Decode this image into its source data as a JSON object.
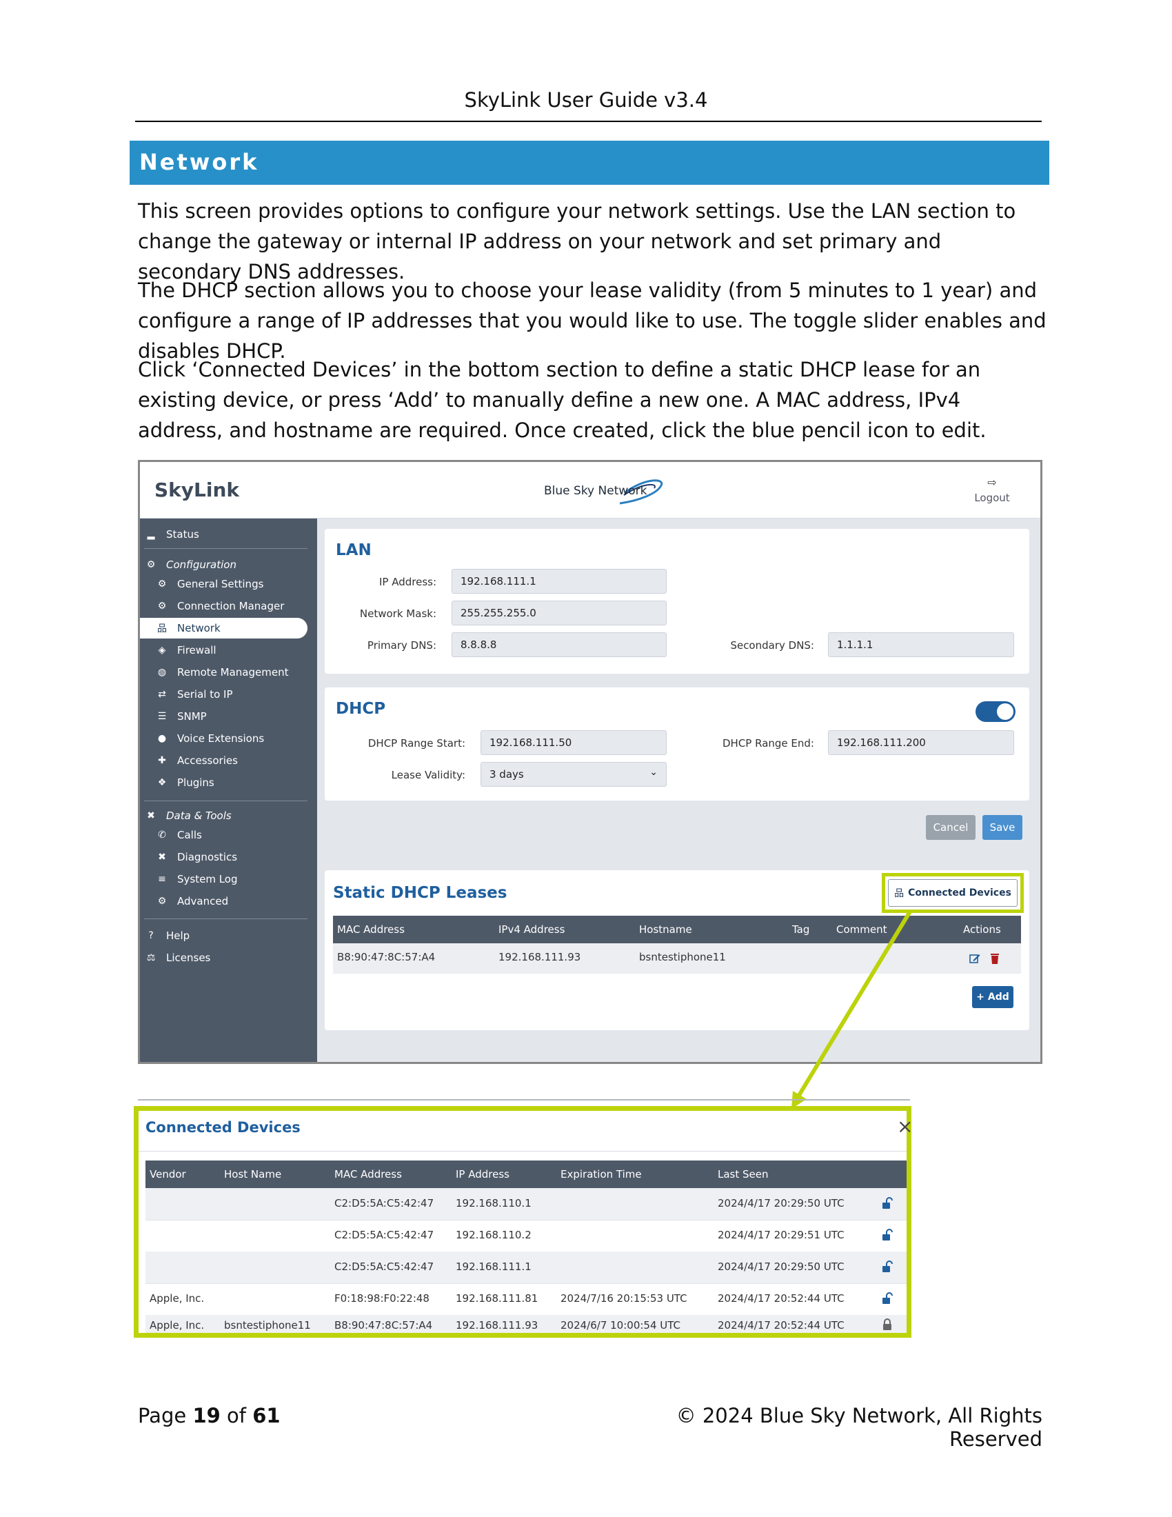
{
  "header": {
    "title": "SkyLink User Guide v3.4"
  },
  "section": {
    "title": "Network"
  },
  "paragraphs": {
    "p1": "This screen provides options to configure your network settings. Use the LAN section to change the gateway or internal IP address on your network and set primary and secondary DNS addresses.",
    "p2": "The DHCP section allows you to choose your lease validity (from 5 minutes to 1 year) and configure a range of IP addresses that you would like to use. The toggle slider enables and disables DHCP.",
    "p3": "Click ‘Connected Devices’ in the bottom section to define a static DHCP lease for an existing device, or press ‘Add’ to manually define a new one. A MAC address, IPv4 address, and hostname are required. Once created, click the blue pencil icon to edit."
  },
  "app": {
    "brand": "SkyLink",
    "partner_logo_text": "Blue Sky Network",
    "logout_label": "Logout",
    "accent": "#1f5f9e",
    "sidebar_bg": "#4e5968",
    "highlight": "#bcd30b"
  },
  "sidebar": {
    "status": "Status",
    "configuration": "Configuration",
    "general_settings": "General Settings",
    "connection_manager": "Connection Manager",
    "network": "Network",
    "firewall": "Firewall",
    "remote_management": "Remote Management",
    "serial_to_ip": "Serial to IP",
    "snmp": "SNMP",
    "voice_extensions": "Voice Extensions",
    "accessories": "Accessories",
    "plugins": "Plugins",
    "data_tools": "Data & Tools",
    "calls": "Calls",
    "diagnostics": "Diagnostics",
    "system_log": "System Log",
    "advanced": "Advanced",
    "help": "Help",
    "licenses": "Licenses"
  },
  "lan": {
    "title": "LAN",
    "ip_label": "IP Address:",
    "ip_value": "192.168.111.1",
    "mask_label": "Network Mask:",
    "mask_value": "255.255.255.0",
    "pdns_label": "Primary DNS:",
    "pdns_value": "8.8.8.8",
    "sdns_label": "Secondary DNS:",
    "sdns_value": "1.1.1.1"
  },
  "dhcp": {
    "title": "DHCP",
    "enabled": true,
    "start_label": "DHCP Range Start:",
    "start_value": "192.168.111.50",
    "end_label": "DHCP Range End:",
    "end_value": "192.168.111.200",
    "lease_label": "Lease Validity:",
    "lease_value": "3 days"
  },
  "buttons": {
    "cancel": "Cancel",
    "save": "Save",
    "add": "+ Add",
    "connected_devices": "Connected Devices"
  },
  "static_leases": {
    "title": "Static DHCP Leases",
    "columns": [
      "MAC Address",
      "IPv4 Address",
      "Hostname",
      "Tag",
      "Comment",
      "Actions"
    ],
    "rows": [
      {
        "mac": "B8:90:47:8C:57:A4",
        "ip": "192.168.111.93",
        "hostname": "bsntestiphone11",
        "tag": "",
        "comment": ""
      }
    ]
  },
  "connected_devices": {
    "title": "Connected Devices",
    "close": "×",
    "columns": [
      "Vendor",
      "Host Name",
      "MAC Address",
      "IP Address",
      "Expiration Time",
      "Last Seen"
    ],
    "rows": [
      {
        "vendor": "",
        "host": "",
        "mac": "C2:D5:5A:C5:42:47",
        "ip": "192.168.110.1",
        "exp": "",
        "seen": "2024/4/17 20:29:50 UTC",
        "lock": "unlocked"
      },
      {
        "vendor": "",
        "host": "",
        "mac": "C2:D5:5A:C5:42:47",
        "ip": "192.168.110.2",
        "exp": "",
        "seen": "2024/4/17 20:29:51 UTC",
        "lock": "unlocked"
      },
      {
        "vendor": "",
        "host": "",
        "mac": "C2:D5:5A:C5:42:47",
        "ip": "192.168.111.1",
        "exp": "",
        "seen": "2024/4/17 20:29:50 UTC",
        "lock": "unlocked"
      },
      {
        "vendor": "Apple, Inc.",
        "host": "",
        "mac": "F0:18:98:F0:22:48",
        "ip": "192.168.111.81",
        "exp": "2024/7/16 20:15:53 UTC",
        "seen": "2024/4/17 20:52:44 UTC",
        "lock": "unlocked"
      },
      {
        "vendor": "Apple, Inc.",
        "host": "bsntestiphone11",
        "mac": "B8:90:47:8C:57:A4",
        "ip": "192.168.111.93",
        "exp": "2024/6/7 10:00:54 UTC",
        "seen": "2024/4/17 20:52:44 UTC",
        "lock": "locked"
      }
    ]
  },
  "footer": {
    "page_prefix": "Page ",
    "page_num": "19",
    "page_of": " of ",
    "page_total": "61",
    "copyright": "© 2024 Blue Sky Network, All Rights Reserved"
  }
}
